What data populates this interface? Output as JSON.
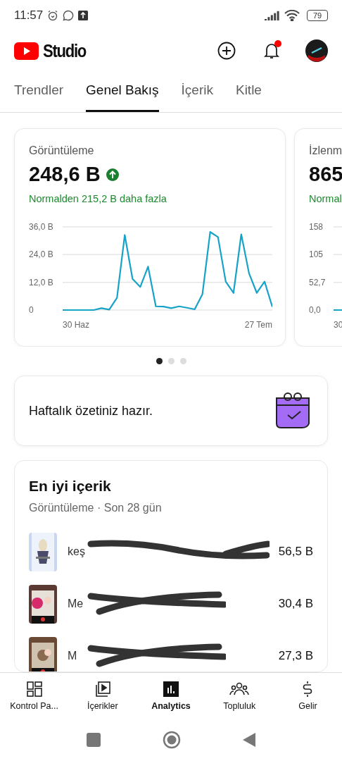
{
  "status_bar": {
    "time": "11:57",
    "battery": "79"
  },
  "app_bar": {
    "title": "Studio",
    "notification_badge": true
  },
  "tabs": [
    {
      "label": "Trendler",
      "selected": false
    },
    {
      "label": "Genel Bakış",
      "selected": true
    },
    {
      "label": "İçerik",
      "selected": false
    },
    {
      "label": "Kitle",
      "selected": false
    }
  ],
  "metric_cards": [
    {
      "title": "Görüntüleme",
      "value": "248,6 B",
      "trend_up": true,
      "comparison": "Normalden 215,2 B daha fazla",
      "date_start": "30 Haz",
      "date_end": "27 Tem",
      "chart_data": {
        "type": "line",
        "categories": [
          null,
          null,
          null,
          null,
          null,
          null,
          null,
          null,
          null,
          null,
          null,
          null,
          null,
          null,
          null,
          null,
          null,
          null,
          null,
          null,
          null,
          null,
          null,
          null,
          null,
          null,
          null,
          null
        ],
        "ylim": [
          0,
          36
        ],
        "yticks": [
          {
            "value": 0,
            "label": "0"
          },
          {
            "value": 12,
            "label": "12,0 B"
          },
          {
            "value": 24,
            "label": "24,0 B"
          },
          {
            "value": 36,
            "label": "36,0 B"
          }
        ],
        "series": [
          {
            "color": "#17a2c8",
            "values": [
              0,
              0,
              0,
              0,
              0,
              0.8,
              0.2,
              5.3,
              32.5,
              13.5,
              10,
              18.8,
              1.6,
              1.5,
              0.8,
              1.6,
              1,
              0.3,
              6.9,
              33.8,
              31.6,
              12.3,
              7.4,
              32.8,
              15.9,
              7.4,
              12.3,
              1.4
            ]
          }
        ]
      }
    },
    {
      "title": "İzlenm",
      "value": "865",
      "comparison": "Normal",
      "axis_labels": [
        "158",
        "105",
        "52,7",
        "0,0"
      ],
      "date_label": "30"
    }
  ],
  "carousel_dots": [
    {
      "selected": true
    },
    {
      "selected": false
    },
    {
      "selected": false
    }
  ],
  "weekly_summary": {
    "text": "Haftalık özetiniz hazır."
  },
  "top_content": {
    "title": "En iyi içerik",
    "subtitle": "Görüntüleme · Son 28 gün",
    "items": [
      {
        "title": "keş",
        "value": "56,5 B"
      },
      {
        "title": "Me",
        "value": "30,4 B"
      },
      {
        "title": "M",
        "value": "27,3 B"
      }
    ]
  },
  "bottom_nav": [
    {
      "label": "Kontrol Pa...",
      "selected": false
    },
    {
      "label": "İçerikler",
      "selected": false
    },
    {
      "label": "Analytics",
      "selected": true
    },
    {
      "label": "Topluluk",
      "selected": false
    },
    {
      "label": "Gelir",
      "selected": false
    }
  ]
}
